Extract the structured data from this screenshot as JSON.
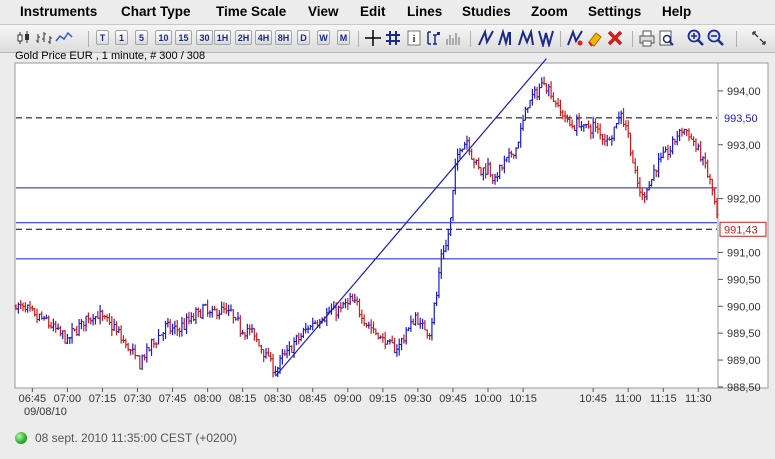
{
  "menu": [
    "Instruments",
    "Chart Type",
    "Time Scale",
    "View",
    "Edit",
    "Lines",
    "Studies",
    "Zoom",
    "Settings",
    "Help"
  ],
  "toolbar": {
    "timescale_buttons": [
      "T",
      "1",
      "5",
      "10",
      "15",
      "30",
      "1H",
      "2H",
      "4H",
      "8H",
      "D",
      "W",
      "M"
    ],
    "icons": [
      "candle-chart-icon",
      "bar-chart-icon",
      "line-chart-icon",
      "crosshair-icon",
      "grid-icon",
      "info-icon",
      "level-icon",
      "volume-icon",
      "trendline-icon",
      "parallel-lines-icon",
      "fan-lines-icon",
      "channel-icon",
      "draw-tool-icon",
      "eraser-icon",
      "delete-icon",
      "print-icon",
      "print-preview-icon",
      "zoom-in-icon",
      "zoom-out-icon",
      "fullscreen-icon"
    ]
  },
  "chart_title": "Gold Price EUR , 1 minute, # 300 / 308",
  "status": {
    "text": "08 sept. 2010 11:35:00  CEST (+0200)",
    "indicator_color": "#2cb52c"
  },
  "chart_data": {
    "type": "bar",
    "style": "ohlc-minute-bars",
    "colors": {
      "up": "#1a1acc",
      "down": "#cc1a1a",
      "lines": "#1a1acc",
      "dashed": "#000000"
    },
    "y_ticks": [
      "994,00",
      "993,00",
      "992,00",
      "991,00",
      "990,50",
      "990,00",
      "989,50",
      "989,00",
      "988,50"
    ],
    "y_tick_values": [
      994.0,
      993.0,
      992.0,
      991.0,
      990.5,
      990.0,
      989.5,
      989.0,
      988.5
    ],
    "ylim": [
      988.5,
      994.5
    ],
    "x_ticks": [
      "06:45",
      "07:00",
      "07:15",
      "07:30",
      "07:45",
      "08:00",
      "08:15",
      "08:30",
      "08:45",
      "09:00",
      "09:15",
      "09:30",
      "09:45",
      "10:00",
      "10:15",
      "10:45",
      "11:00",
      "11:15",
      "11:30"
    ],
    "x_tick_minutes": [
      405,
      420,
      435,
      450,
      465,
      480,
      495,
      510,
      525,
      540,
      555,
      570,
      585,
      600,
      615,
      645,
      660,
      675,
      690
    ],
    "xlim": [
      398,
      698
    ],
    "date_label": "09/08/10",
    "price_labels": [
      {
        "text": "993,50",
        "value": 993.5,
        "style": "dashed"
      },
      {
        "text": "991,43",
        "value": 991.43,
        "style": "dashed-current"
      }
    ],
    "horizontal_lines": [
      {
        "value": 993.5,
        "style": "dashed"
      },
      {
        "value": 992.2,
        "style": "solid"
      },
      {
        "value": 991.55,
        "style": "solid"
      },
      {
        "value": 991.43,
        "style": "dashed"
      },
      {
        "value": 990.88,
        "style": "solid"
      }
    ],
    "trend_line": {
      "start": {
        "minute": 509,
        "value": 988.7
      },
      "end": {
        "minute": 625,
        "value": 994.6
      }
    },
    "path": [
      [
        398,
        990.0
      ],
      [
        402,
        989.95
      ],
      [
        406,
        989.8
      ],
      [
        410,
        989.75
      ],
      [
        414,
        989.6
      ],
      [
        418,
        989.45
      ],
      [
        420,
        989.35
      ],
      [
        424,
        989.6
      ],
      [
        428,
        989.75
      ],
      [
        432,
        989.85
      ],
      [
        436,
        989.75
      ],
      [
        440,
        989.6
      ],
      [
        444,
        989.35
      ],
      [
        448,
        989.1
      ],
      [
        451,
        988.95
      ],
      [
        454,
        989.15
      ],
      [
        458,
        989.4
      ],
      [
        462,
        989.6
      ],
      [
        466,
        989.55
      ],
      [
        470,
        989.65
      ],
      [
        474,
        989.8
      ],
      [
        478,
        989.95
      ],
      [
        482,
        989.85
      ],
      [
        486,
        989.95
      ],
      [
        490,
        989.85
      ],
      [
        494,
        989.6
      ],
      [
        498,
        989.55
      ],
      [
        502,
        989.3
      ],
      [
        506,
        989.05
      ],
      [
        509,
        988.8
      ],
      [
        513,
        989.1
      ],
      [
        517,
        989.3
      ],
      [
        521,
        989.5
      ],
      [
        525,
        989.7
      ],
      [
        529,
        989.8
      ],
      [
        533,
        989.9
      ],
      [
        537,
        989.95
      ],
      [
        541,
        990.1
      ],
      [
        544,
        990.0
      ],
      [
        548,
        989.7
      ],
      [
        552,
        989.5
      ],
      [
        556,
        989.35
      ],
      [
        560,
        989.2
      ],
      [
        563,
        989.35
      ],
      [
        566,
        989.6
      ],
      [
        569,
        989.8
      ],
      [
        572,
        989.6
      ],
      [
        575,
        989.55
      ],
      [
        578,
        990.2
      ],
      [
        580,
        990.95
      ],
      [
        582,
        991.1
      ],
      [
        584,
        991.6
      ],
      [
        586,
        992.6
      ],
      [
        588,
        992.95
      ],
      [
        591,
        993.1
      ],
      [
        594,
        992.7
      ],
      [
        597,
        992.5
      ],
      [
        600,
        992.6
      ],
      [
        603,
        992.35
      ],
      [
        606,
        992.6
      ],
      [
        609,
        992.75
      ],
      [
        612,
        992.95
      ],
      [
        615,
        993.4
      ],
      [
        617,
        993.8
      ],
      [
        619,
        993.85
      ],
      [
        622,
        994.05
      ],
      [
        624,
        994.2
      ],
      [
        627,
        993.95
      ],
      [
        630,
        993.7
      ],
      [
        633,
        993.5
      ],
      [
        636,
        993.35
      ],
      [
        639,
        993.4
      ],
      [
        642,
        993.3
      ],
      [
        645,
        993.35
      ],
      [
        648,
        993.2
      ],
      [
        651,
        993.1
      ],
      [
        654,
        993.3
      ],
      [
        657,
        993.6
      ],
      [
        660,
        993.2
      ],
      [
        663,
        992.4
      ],
      [
        666,
        992.0
      ],
      [
        669,
        992.3
      ],
      [
        672,
        992.6
      ],
      [
        675,
        992.8
      ],
      [
        678,
        992.9
      ],
      [
        681,
        993.2
      ],
      [
        684,
        993.3
      ],
      [
        687,
        993.1
      ],
      [
        690,
        992.9
      ],
      [
        693,
        992.6
      ],
      [
        695,
        992.3
      ],
      [
        697,
        991.9
      ],
      [
        698,
        991.6
      ]
    ]
  }
}
